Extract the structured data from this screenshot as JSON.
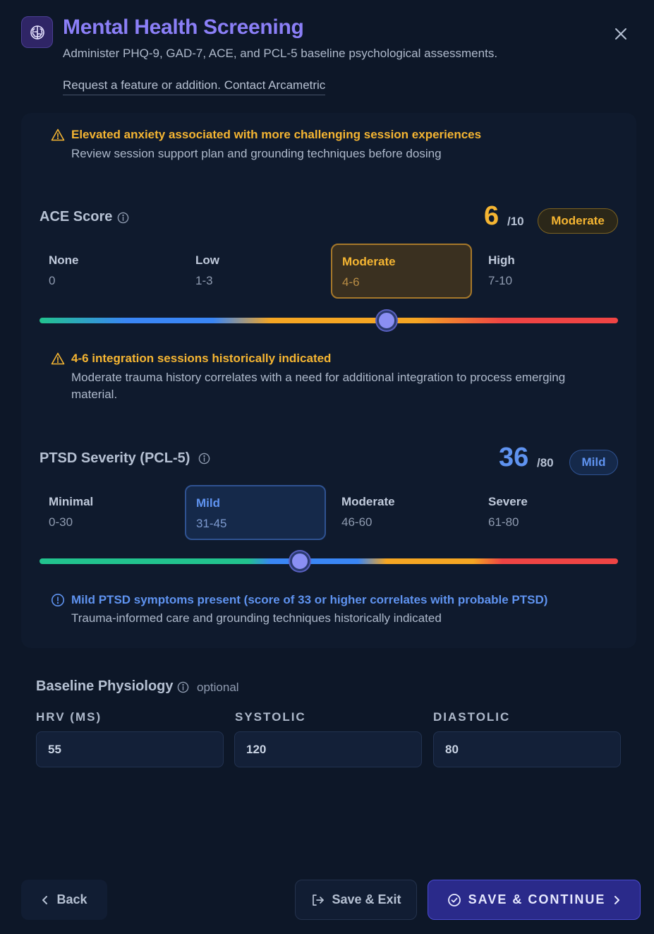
{
  "header": {
    "title": "Mental Health Screening",
    "subtitle": "Administer PHQ-9, GAD-7, ACE, and PCL-5 baseline psychological assessments.",
    "request_link": "Request a feature or addition. Contact Arcametric"
  },
  "anxiety_alert": {
    "title": "Elevated anxiety associated with more challenging session experiences",
    "body": "Review session support plan and grounding techniques before dosing"
  },
  "ace": {
    "title": "ACE Score",
    "score": "6",
    "max": "/10",
    "badge": "Moderate",
    "slider_value": 6,
    "slider_max": 10,
    "ranges": [
      {
        "name": "None",
        "value": "0"
      },
      {
        "name": "Low",
        "value": "1-3"
      },
      {
        "name": "Moderate",
        "value": "4-6"
      },
      {
        "name": "High",
        "value": "7-10"
      }
    ],
    "alert_title": "4-6 integration sessions historically indicated",
    "alert_body": "Moderate trauma history correlates with a need for additional integration to process emerging material."
  },
  "ptsd": {
    "title": "PTSD Severity (PCL-5)",
    "score": "36",
    "max": "/80",
    "badge": "Mild",
    "slider_value": 36,
    "slider_max": 80,
    "ranges": [
      {
        "name": "Minimal",
        "value": "0-30"
      },
      {
        "name": "Mild",
        "value": "31-45"
      },
      {
        "name": "Moderate",
        "value": "46-60"
      },
      {
        "name": "Severe",
        "value": "61-80"
      }
    ],
    "alert_title": "Mild PTSD symptoms present (score of 33 or higher correlates with probable PTSD)",
    "alert_body": "Trauma-informed care and grounding techniques historically indicated"
  },
  "physiology": {
    "title": "Baseline Physiology",
    "optional": "optional",
    "fields": [
      {
        "label": "HRV (MS)",
        "value": "55"
      },
      {
        "label": "SYSTOLIC",
        "value": "120"
      },
      {
        "label": "DIASTOLIC",
        "value": "80"
      }
    ]
  },
  "footer": {
    "back": "Back",
    "save_exit": "Save & Exit",
    "save_continue": "SAVE & CONTINUE"
  },
  "colors": {
    "accent": "#8b7ff7",
    "amber": "#f5b532",
    "blue": "#5f93f0"
  }
}
